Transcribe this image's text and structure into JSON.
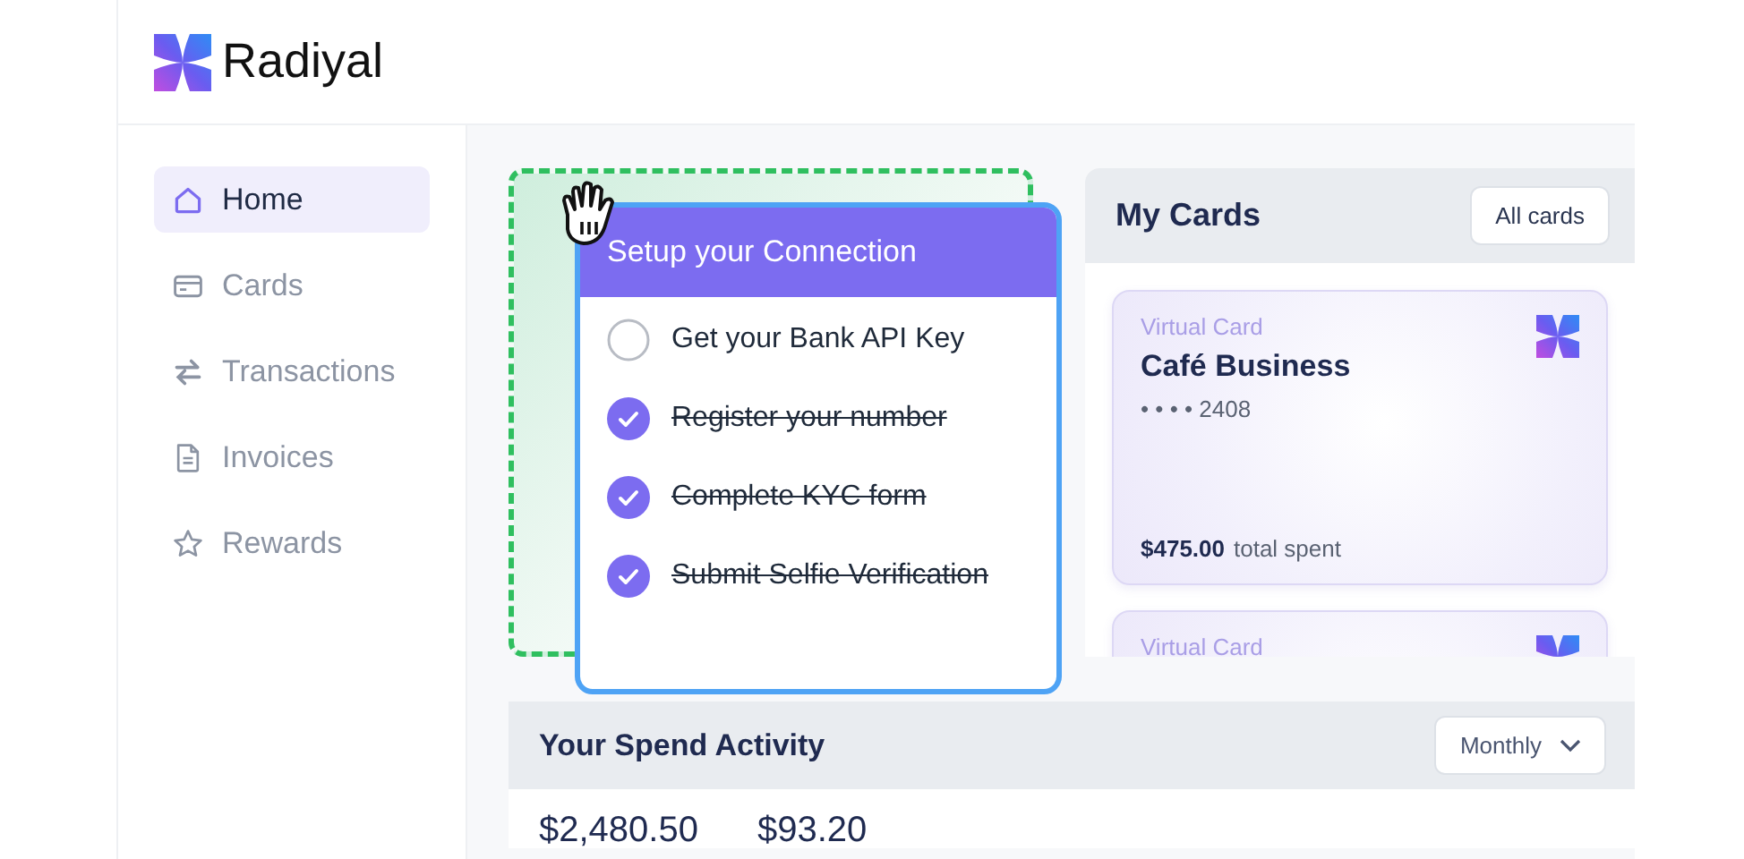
{
  "brand": {
    "name": "Radiyal"
  },
  "sidebar": {
    "items": [
      {
        "label": "Home",
        "selected": true
      },
      {
        "label": "Cards",
        "selected": false
      },
      {
        "label": "Transactions",
        "selected": false
      },
      {
        "label": "Invoices",
        "selected": false
      },
      {
        "label": "Rewards",
        "selected": false
      }
    ]
  },
  "setup": {
    "title": "Setup your Connection",
    "tasks": [
      {
        "label": "Get your Bank API Key",
        "done": false
      },
      {
        "label": "Register your number",
        "done": true
      },
      {
        "label": "Complete KYC form",
        "done": true
      },
      {
        "label": "Submit Selfie Verification",
        "done": true
      }
    ]
  },
  "cards_panel": {
    "title": "My Cards",
    "button": "All cards",
    "cards": [
      {
        "type_label": "Virtual Card",
        "name": "Café Business",
        "number": "• • • • 2408",
        "amount": "$475.00",
        "amount_label": "total spent"
      },
      {
        "type_label": "Virtual Card"
      }
    ]
  },
  "spend": {
    "title": "Your Spend Activity",
    "period": "Monthly",
    "amounts": [
      "$2,480.50",
      "$93.20"
    ]
  }
}
